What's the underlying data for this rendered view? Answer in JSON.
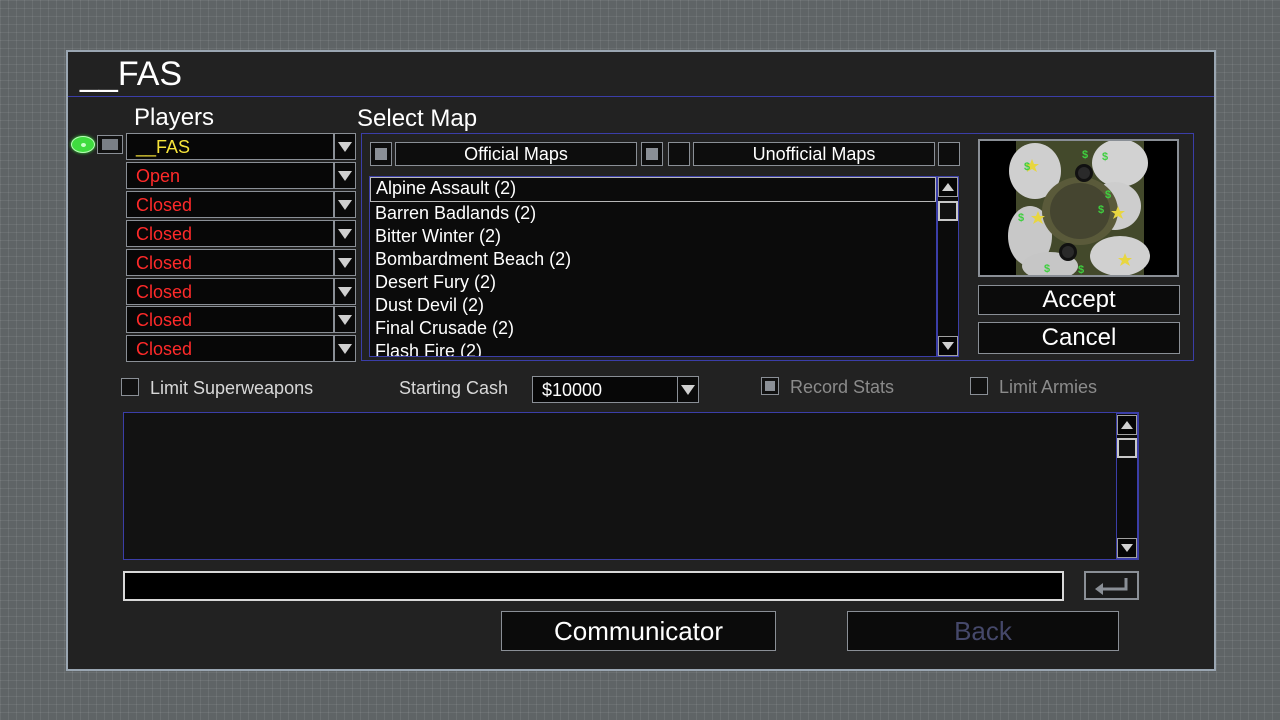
{
  "game_title": "__FAS",
  "players": {
    "label": "Players",
    "slots": [
      {
        "name": "__FAS",
        "state": "host"
      },
      {
        "name": "Open",
        "state": "open"
      },
      {
        "name": "Closed",
        "state": "closed"
      },
      {
        "name": "Closed",
        "state": "closed"
      },
      {
        "name": "Closed",
        "state": "closed"
      },
      {
        "name": "Closed",
        "state": "closed"
      },
      {
        "name": "Closed",
        "state": "closed"
      },
      {
        "name": "Closed",
        "state": "closed"
      }
    ]
  },
  "map_select": {
    "label": "Select Map",
    "tabs": {
      "official": {
        "label": "Official Maps",
        "checked": true
      },
      "unofficial": {
        "label": "Unofficial Maps",
        "checked": false
      }
    },
    "maps": [
      "Alpine Assault (2)",
      "Barren Badlands (2)",
      "Bitter Winter (2)",
      "Bombardment Beach (2)",
      "Desert Fury (2)",
      "Dust Devil (2)",
      "Final Crusade (2)",
      "Flash Fire (2)"
    ],
    "selected_index": 0,
    "accept_label": "Accept",
    "cancel_label": "Cancel"
  },
  "options": {
    "limit_superweapons": {
      "label": "Limit Superweapons",
      "checked": false
    },
    "starting_cash": {
      "label": "Starting Cash",
      "value": "$10000"
    },
    "record_stats": {
      "label": "Record Stats",
      "checked": true
    },
    "limit_armies": {
      "label": "Limit Armies",
      "checked": false
    }
  },
  "chat": {
    "input_value": "",
    "send_icon": "enter-arrow-icon"
  },
  "footer": {
    "communicator_label": "Communicator",
    "back_label": "Back"
  },
  "colors": {
    "frame_bg": "#222222",
    "open_closed_text": "#ff2a2a",
    "host_text": "#f5e33a",
    "accent_border": "#3b3ea8",
    "disabled_text": "#45486a",
    "ready_indicator": "#3fdc3f"
  }
}
